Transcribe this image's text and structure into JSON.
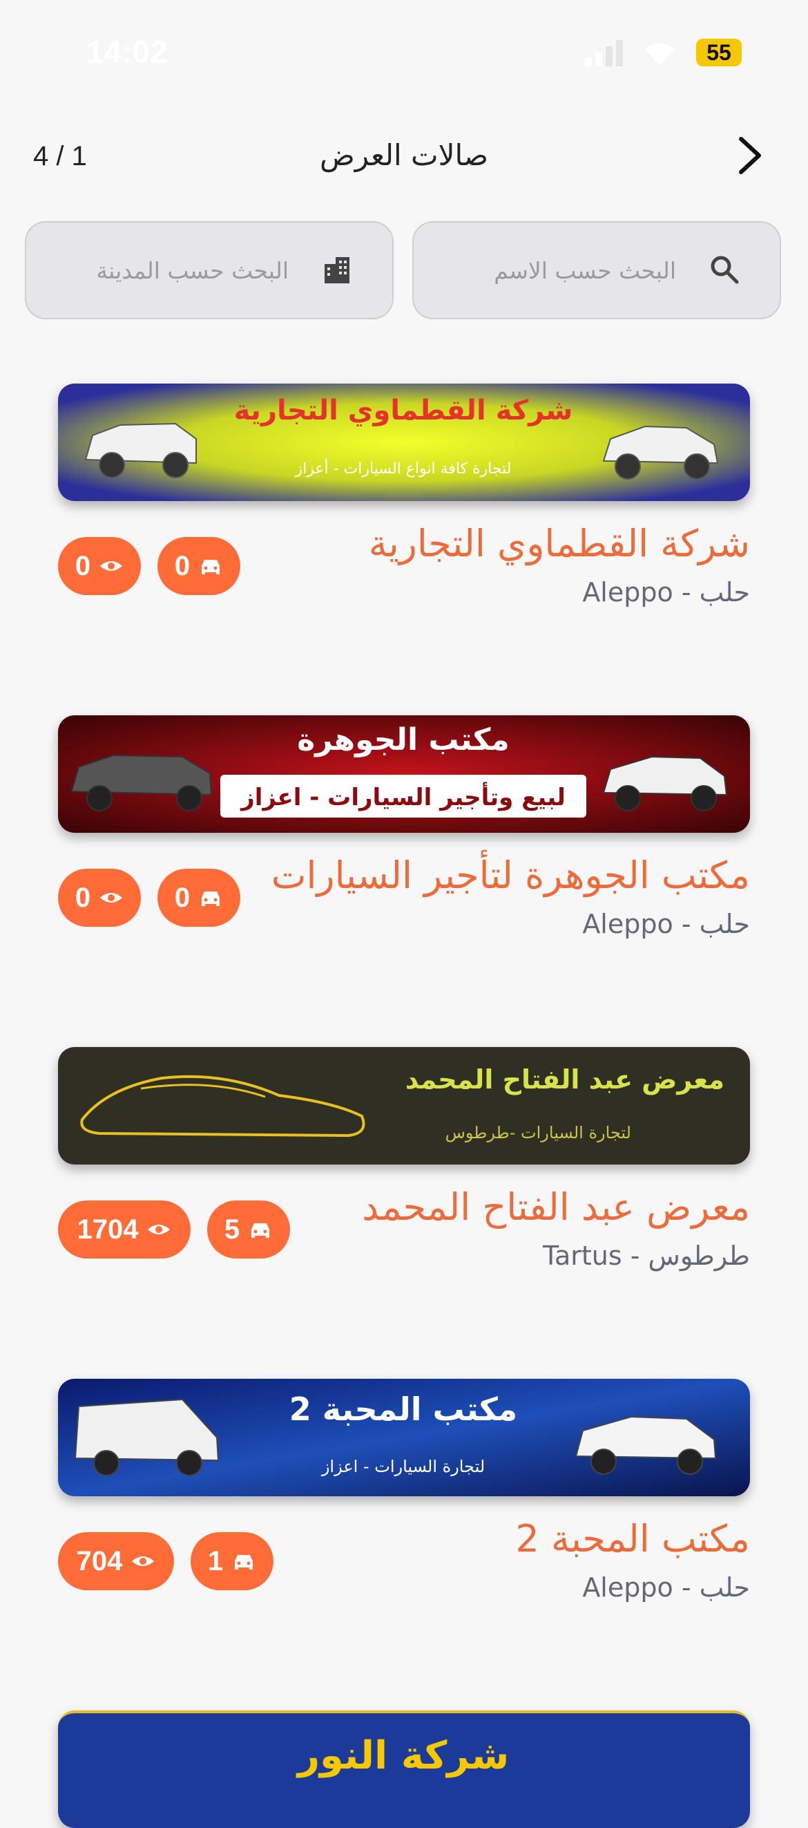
{
  "status_bar": {
    "time": "14:02",
    "battery": "55"
  },
  "header": {
    "title": "صالات العرض",
    "page_counter": "4 / 1"
  },
  "search": {
    "name_placeholder": "البحث حسب الاسم",
    "city_placeholder": "البحث حسب المدينة"
  },
  "colors": {
    "accent": "#ff6c37",
    "name_text": "#ec6b3b"
  },
  "showrooms": [
    {
      "name": "شركة القطماوي التجارية",
      "city": "Aleppo - حلب",
      "cars": "0",
      "views": "0",
      "banner_title": "شركة القطماوي التجارية",
      "banner_subtitle": "لتجارة كافة انواع السيارات - أعزاز"
    },
    {
      "name": "مكتب الجوهرة لتأجير السيارات",
      "city": "Aleppo - حلب",
      "cars": "0",
      "views": "0",
      "banner_title": "مكتب الجوهرة",
      "banner_subtitle": "لبيع وتأجير السيارات - اعزاز"
    },
    {
      "name": "معرض عبد الفتاح المحمد",
      "city": "Tartus - طرطوس",
      "cars": "5",
      "views": "1704",
      "banner_title": "معرض عبد الفتاح المحمد",
      "banner_subtitle": "لتجارة السيارات -طرطوس"
    },
    {
      "name": "مكتب المحبة 2",
      "city": "Aleppo - حلب",
      "cars": "1",
      "views": "704",
      "banner_title": "مكتب المحبة 2",
      "banner_subtitle": "لتجارة السيارات - اعزاز"
    },
    {
      "banner_title": "شركة النور"
    }
  ]
}
